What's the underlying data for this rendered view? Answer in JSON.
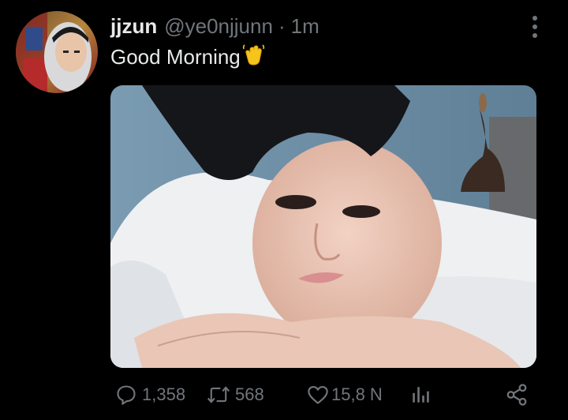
{
  "tweet": {
    "display_name": "jjzun",
    "handle": "@ye0njjunn",
    "separator": "·",
    "time": "1m",
    "text": "Good Morning",
    "emoji": "waving-hand-emoji"
  },
  "actions": {
    "replies": "1,358",
    "retweets": "568",
    "likes": "15,8 N",
    "icons": [
      "reply-icon",
      "retweet-icon",
      "like-icon",
      "analytics-icon",
      "share-icon"
    ]
  },
  "colors": {
    "background": "#000000",
    "primary_text": "#e7e9ea",
    "secondary_text": "#71767b"
  }
}
